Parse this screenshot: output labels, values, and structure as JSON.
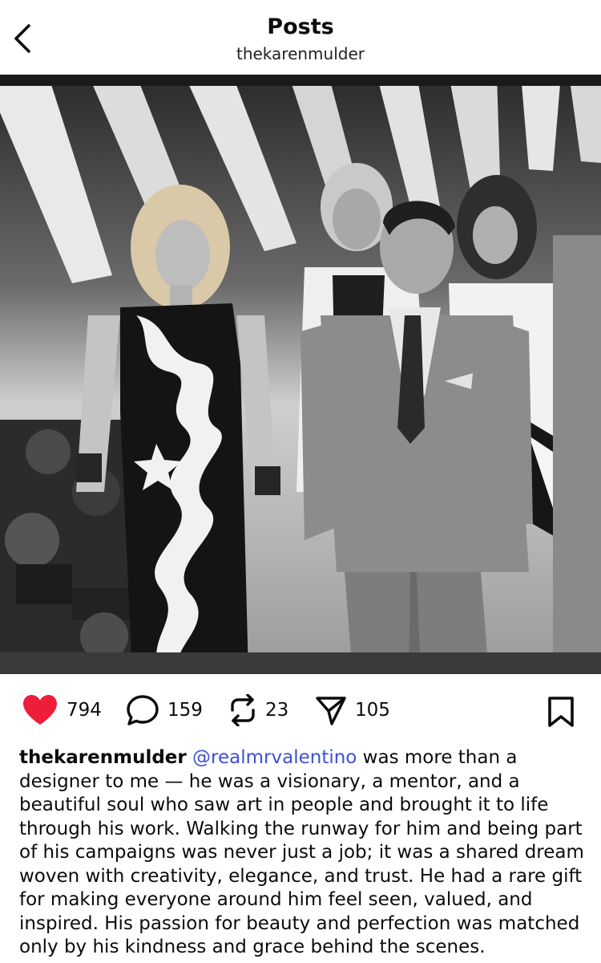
{
  "header": {
    "title": "Posts",
    "username": "thekarenmulder"
  },
  "post": {
    "stats": {
      "likes": "794",
      "comments": "159",
      "reposts": "23",
      "shares": "105"
    },
    "caption": {
      "username": "thekarenmulder",
      "mention": "@realmrvalentino",
      "text": " was more than a designer to me — he was a visionary, a mentor, and a beautiful soul who saw art in people and brought it to life through his work. Walking the runway for him and being part of his campaigns was never just a job; it was a shared dream woven with creativity, elegance, and trust. He had a rare gift for making everyone around him feel seen, valued, and inspired. His passion for beauty and perfection was matched only by his kindness and grace behind the scenes."
    }
  },
  "colors": {
    "like": "#ee1d3a",
    "mention": "#3d4fd6",
    "text": "#0b0b0b"
  },
  "icons": {
    "back": "chevron-left-icon",
    "like": "heart-filled-icon",
    "comment": "speech-bubble-icon",
    "repost": "repost-arrows-icon",
    "share": "paper-plane-icon",
    "save": "bookmark-icon"
  }
}
